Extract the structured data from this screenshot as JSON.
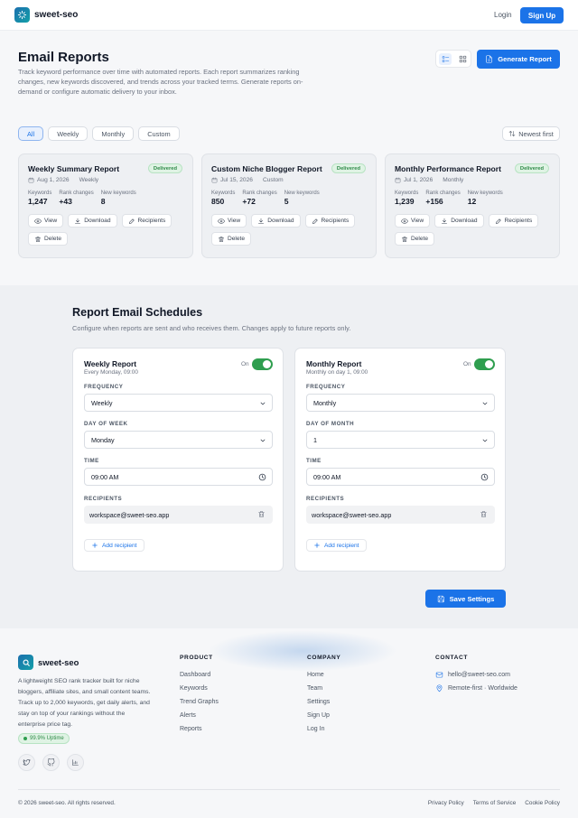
{
  "header": {
    "brand": "sweet-seo",
    "login": "Login",
    "signup": "Sign Up"
  },
  "reports": {
    "title": "Email Reports",
    "description": "Track keyword performance over time with automated reports. Each report summarizes ranking changes, new keywords discovered, and trends across your tracked terms. Generate reports on-demand or configure automatic delivery to your inbox.",
    "generate_label": "Generate Report",
    "filters": [
      "All",
      "Weekly",
      "Monthly",
      "Custom"
    ],
    "active_filter": "All",
    "sort_label": "Newest first",
    "cards": [
      {
        "title": "Weekly Summary Report",
        "status": "Delivered",
        "date": "Aug 1, 2026",
        "type": "Weekly",
        "stats": [
          {
            "label": "Keywords",
            "value": "1,247"
          },
          {
            "label": "Rank changes",
            "value": "+43"
          },
          {
            "label": "New keywords",
            "value": "8"
          }
        ]
      },
      {
        "title": "Custom Niche Blogger Report",
        "status": "Delivered",
        "date": "Jul 15, 2026",
        "type": "Custom",
        "stats": [
          {
            "label": "Keywords",
            "value": "850"
          },
          {
            "label": "Rank changes",
            "value": "+72"
          },
          {
            "label": "New keywords",
            "value": "5"
          }
        ]
      },
      {
        "title": "Monthly Performance Report",
        "status": "Delivered",
        "date": "Jul 1, 2026",
        "type": "Monthly",
        "stats": [
          {
            "label": "Keywords",
            "value": "1,239"
          },
          {
            "label": "Rank changes",
            "value": "+156"
          },
          {
            "label": "New keywords",
            "value": "12"
          }
        ]
      }
    ],
    "actions": {
      "view": "View",
      "download": "Download",
      "recipients": "Recipients",
      "delete": "Delete"
    }
  },
  "schedules": {
    "title": "Report Email Schedules",
    "description": "Configure when reports are sent and who receives them. Changes apply to future reports only.",
    "labels": {
      "on": "On",
      "frequency": "FREQUENCY",
      "time": "TIME",
      "recipients": "RECIPIENTS",
      "add_recipient": "Add recipient"
    },
    "cards": [
      {
        "title": "Weekly Report",
        "subtitle": "Every Monday, 09:00",
        "frequency": "Weekly",
        "day_label": "DAY OF WEEK",
        "day_value": "Monday",
        "time": "09:00 AM",
        "recipient": "workspace@sweet-seo.app",
        "enabled": true
      },
      {
        "title": "Monthly Report",
        "subtitle": "Monthly on day 1, 09:00",
        "frequency": "Monthly",
        "day_label": "DAY OF MONTH",
        "day_value": "1",
        "time": "09:00 AM",
        "recipient": "workspace@sweet-seo.app",
        "enabled": true
      }
    ],
    "save_label": "Save Settings"
  },
  "footer": {
    "brand": "sweet-seo",
    "description": "A lightweight SEO rank tracker built for niche bloggers, affiliate sites, and small content teams. Track up to 2,000 keywords, get daily alerts, and stay on top of your rankings without the enterprise price tag.",
    "uptime": "99.9% Uptime",
    "socials": [
      "twitter-icon",
      "github-icon",
      "chart-icon"
    ],
    "product": {
      "heading": "PRODUCT",
      "links": [
        "Dashboard",
        "Keywords",
        "Trend Graphs",
        "Alerts",
        "Reports"
      ]
    },
    "company": {
      "heading": "COMPANY",
      "links": [
        "Home",
        "Team",
        "Settings",
        "Sign Up",
        "Log In"
      ]
    },
    "contact": {
      "heading": "CONTACT",
      "email": "hello@sweet-seo.com",
      "location": "Remote-first · Worldwide"
    },
    "copyright": "© 2026 sweet-seo. All rights reserved.",
    "legal": [
      "Privacy Policy",
      "Terms of Service",
      "Cookie Policy"
    ]
  },
  "colors": {
    "accent": "#1b73e8",
    "success": "#2f9e4f",
    "badge_bg": "#dff3e4"
  }
}
